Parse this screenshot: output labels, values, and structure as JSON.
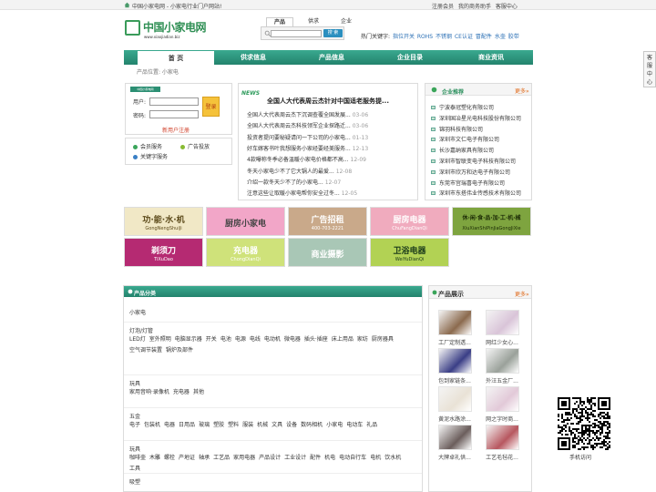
{
  "topbar": {
    "site": "中国小家电网 - 小家电行业门户网站!",
    "links": [
      "注册会员",
      "我的商务助手",
      "客服中心"
    ]
  },
  "logo": {
    "text": "中国小家电网",
    "url": "www.xiaojiadian.biz"
  },
  "search": {
    "tabs": [
      "产品",
      "供求",
      "企业"
    ],
    "value": "",
    "button": "搜 索",
    "hot_label": "热门关键字:",
    "hot_keywords": [
      "指位开关",
      "ROHS",
      "不锈钢",
      "CE认证",
      "冒配件",
      "水壶",
      "胶带"
    ]
  },
  "nav": [
    "首 页",
    "供求信息",
    "产品信息",
    "企业目录",
    "商业资讯"
  ],
  "breadcrumb": "产品位置: 小家电",
  "login": {
    "badge": "中国小家电网",
    "user_label": "用户:",
    "pass_label": "密码:",
    "login_button": "登录",
    "register": "新用户注册",
    "services": [
      "会员服务",
      "广告投放",
      "关键字服务"
    ]
  },
  "news": {
    "logo": "NEWS",
    "headline": "全国人大代表周云杰针对中国适老服务提...",
    "items": [
      {
        "title": "全国人大代表周云杰下沉调查覆全国发展...",
        "date": "03-06"
      },
      {
        "title": "全国人大代表周云杰科技领军企业探路迁...",
        "date": "03-06"
      },
      {
        "title": "投资者提问要秘疑请问一下公司的小家电...",
        "date": "01-13"
      },
      {
        "title": "好车嫁客书叶我想服务小家经要经美服务...",
        "date": "12-13"
      },
      {
        "title": "4款曝称冬季必备温暖小家电价格都不高...",
        "date": "12-09"
      },
      {
        "title": "冬天小家电少不了它大锅人的最爱...",
        "date": "12-08"
      },
      {
        "title": "介绍一款冬天少不了的小家电...",
        "date": "12-07"
      },
      {
        "title": "注意这些让取暖小家电帮你安全过冬...",
        "date": "12-05"
      }
    ]
  },
  "enterprises": {
    "title": "企业推荐",
    "more": "更多»",
    "items": [
      "宁波泰冠塑化有限公司",
      "深圳国冶星光电科技股份有限公司",
      "锦羽科技有限公司",
      "深圳市文仁电子有限公司",
      "长沙嘉纳家具有限公司",
      "深圳市智联变电子科技有限公司",
      "深圳市欣万和达电子有限公司",
      "东莞市宫瑞喜电子有限公司",
      "深圳市东搭伟业传感技术有限公司"
    ]
  },
  "banners": [
    {
      "title": "功·能·水·机",
      "sub": "GongNengShuiJi",
      "bg": "#f1e8c6",
      "fg": "#5c4a1a"
    },
    {
      "title": "厨房小家电",
      "sub": "",
      "bg": "#f2a6c8",
      "fg": "#444444"
    },
    {
      "title": "广告招租",
      "sub": "400-703-2221",
      "bg": "#c9a98a",
      "fg": "#ffffff"
    },
    {
      "title": "厨房电器",
      "sub": "ChuFangDianQi",
      "bg": "#f0abbe",
      "fg": "#ffffff"
    },
    {
      "title": "休·闲·食·品·加·工·机·械",
      "sub": "XiuXianShiPinJiaGongJiXie",
      "bg": "#7ea43f",
      "fg": "#1b2a05"
    },
    {
      "title": "剃须刀",
      "sub": "TiXuDao",
      "bg": "#b52a72",
      "fg": "#ffffff"
    },
    {
      "title": "充电器",
      "sub": "ChongDianQi",
      "bg": "#cfe27a",
      "fg": "#ffffff"
    },
    {
      "title": "商业摄影",
      "sub": "",
      "bg": "#a9c7b6",
      "fg": "#ffffff"
    },
    {
      "title": "卫浴电器",
      "sub": "WeiYuDianQi",
      "bg": "#b2d254",
      "fg": "#1a3a1a"
    }
  ],
  "categories": {
    "title": "产品分类",
    "groups": [
      {
        "name": "小家电",
        "items": []
      },
      {
        "name": "灯泡/灯管",
        "items": [
          "LED灯",
          "室外照明",
          "电脑显示器",
          "开关",
          "电池",
          "电源",
          "电线",
          "电动机",
          "微电器",
          "插头·插座",
          "床上用品",
          "家纺",
          "厨房器具",
          "空气调节装置",
          "锅炉及部件"
        ]
      },
      {
        "name": "玩具",
        "items": [
          "家用音响·录像机",
          "充电器",
          "其他"
        ]
      },
      {
        "name": "五金",
        "items": [
          "电子",
          "包装机",
          "电器",
          "日用品",
          "玻璃",
          "塑胶",
          "塑料",
          "服装",
          "机械",
          "文具",
          "设备",
          "数码相机",
          "小家电",
          "电动车",
          "礼品"
        ]
      },
      {
        "name": "玩具",
        "items": [
          "咖啡壶",
          "木雕",
          "螺栓",
          "产地证",
          "轴承",
          "工艺品",
          "家用电器",
          "产品设计",
          "工业设计",
          "配件",
          "机电",
          "电动自行车",
          "电机",
          "饮水机",
          "工具"
        ]
      },
      {
        "name": "吸塑",
        "items": []
      }
    ]
  },
  "products": {
    "title": "产品展示",
    "more": "更多»",
    "items": [
      {
        "caption": "工厂定制透...",
        "color": "#8b6a4e"
      },
      {
        "caption": "网红少女心...",
        "color": "#d9c4d8"
      },
      {
        "caption": "包到家链条...",
        "color": "#3a3e86"
      },
      {
        "caption": "外汪五金厂...",
        "color": "#9aa19a"
      },
      {
        "caption": "黄泥水路涂...",
        "color": "#e9e2d6"
      },
      {
        "caption": "网之字时商...",
        "color": "#e2c9d8"
      },
      {
        "caption": "大牌卓礼供...",
        "color": "#6b5e5c"
      },
      {
        "caption": "工艺毛毡花...",
        "color": "#b7575f"
      }
    ]
  },
  "qr": {
    "caption": "手机访问"
  },
  "side_tab": "客服中心"
}
